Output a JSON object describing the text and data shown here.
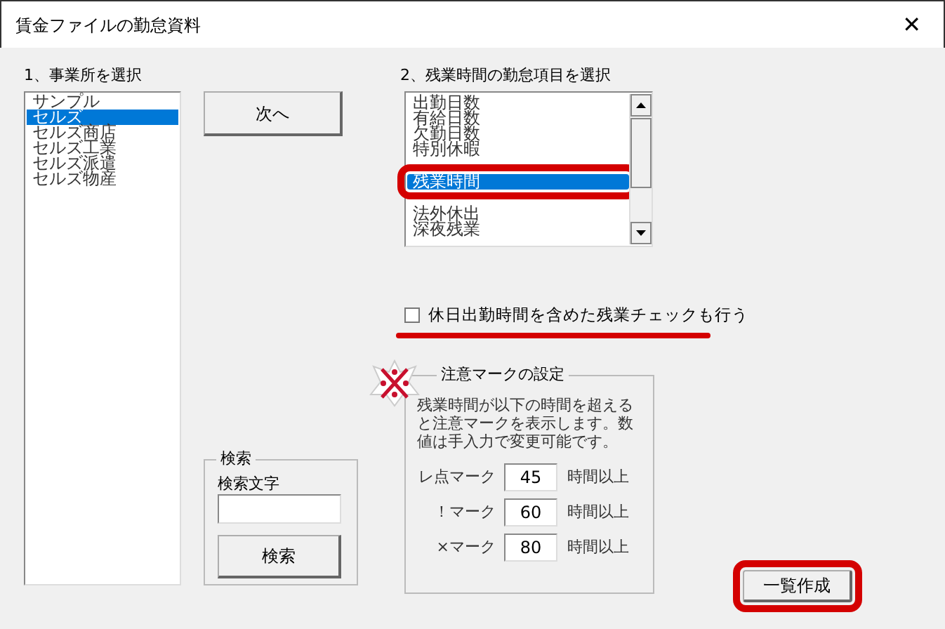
{
  "window": {
    "title": "賃金ファイルの勤怠資料",
    "close": "✕"
  },
  "office_section": {
    "label": "1、事業所を選択",
    "items": [
      {
        "label": "サンプル",
        "selected": false
      },
      {
        "label": "セルズ",
        "selected": true
      },
      {
        "label": "セルズ商店",
        "selected": false
      },
      {
        "label": "セルズ工業",
        "selected": false
      },
      {
        "label": "セルズ派遣",
        "selected": false
      },
      {
        "label": "セルズ物産",
        "selected": false
      }
    ]
  },
  "next_button": {
    "label": "次へ"
  },
  "item_section": {
    "label": "2、残業時間の勤怠項目を選択",
    "items": [
      {
        "label": "出勤日数",
        "selected": false,
        "highlighted": false
      },
      {
        "label": "有給日数",
        "selected": false,
        "highlighted": false
      },
      {
        "label": "欠勤日数",
        "selected": false,
        "highlighted": false
      },
      {
        "label": "特別休暇",
        "selected": false,
        "highlighted": false
      },
      {
        "label": "残業時間",
        "selected": true,
        "highlighted": true
      },
      {
        "label": "法外休出",
        "selected": false,
        "highlighted": false
      },
      {
        "label": "深夜残業",
        "selected": false,
        "highlighted": false
      }
    ]
  },
  "holiday_check": {
    "label": "休日出勤時間を含めた残業チェックも行う",
    "checked": false,
    "underlined": true
  },
  "search": {
    "title": "検索",
    "label": "検索文字",
    "button": "検索"
  },
  "mark_settings": {
    "title": "注意マークの設定",
    "description": "残業時間が以下の時間を超えると注意マークを表示します。数値は手入力で変更可能です。",
    "rows": [
      {
        "label": "レ点マーク",
        "value": "45",
        "unit": "時間以上"
      },
      {
        "label": "！マーク",
        "value": "60",
        "unit": "時間以上"
      },
      {
        "label": "×マーク",
        "value": "80",
        "unit": "時間以上"
      }
    ]
  },
  "create_button": {
    "label": "一覧作成",
    "highlighted": true
  }
}
